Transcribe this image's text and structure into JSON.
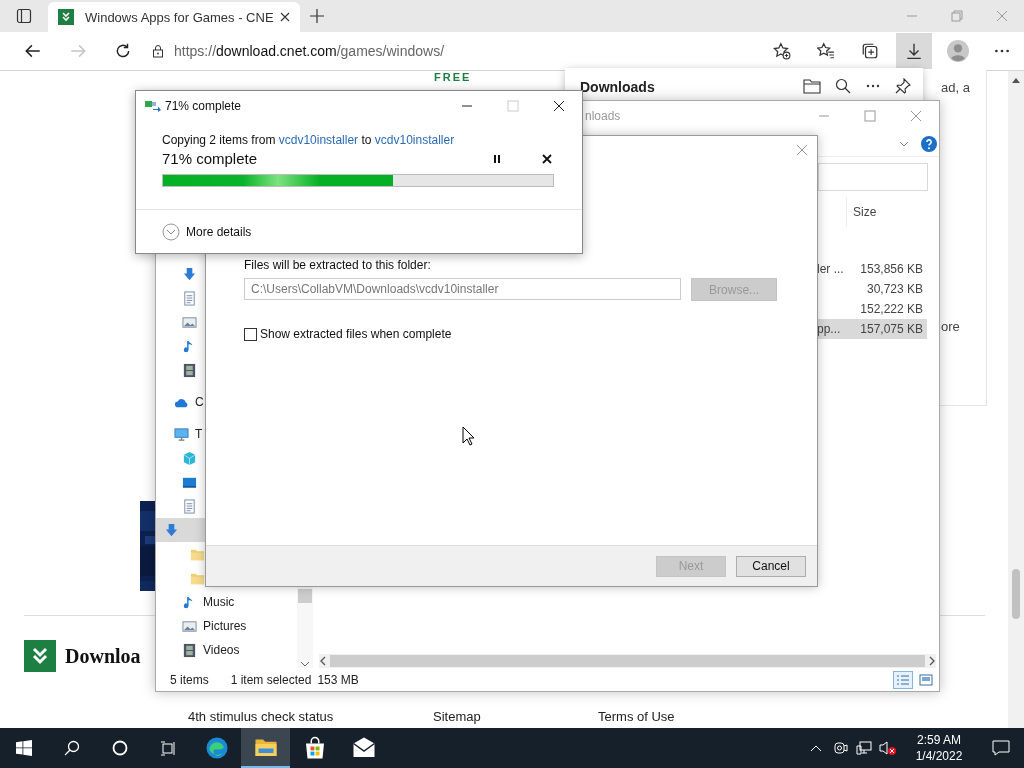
{
  "browser": {
    "tab": {
      "title": "Windows Apps for Games - CNE",
      "selected": true
    },
    "nav_buttons": [
      {
        "kind": "back",
        "disabled": false
      },
      {
        "kind": "forward",
        "disabled": true
      },
      {
        "kind": "refresh",
        "disabled": false
      }
    ],
    "url": {
      "scheme": "https://",
      "host": "download.cnet.com",
      "path": "/games/windows/"
    },
    "toolbar": [
      {
        "kind": "favorite-add",
        "selected": false
      },
      {
        "kind": "favorites",
        "selected": false
      },
      {
        "kind": "collections",
        "selected": false
      },
      {
        "kind": "downloads",
        "selected": true
      },
      {
        "kind": "profile",
        "selected": false
      },
      {
        "kind": "more",
        "selected": false
      }
    ]
  },
  "page": {
    "badge": "FREE",
    "side_texts": [
      "ad, a",
      "ore"
    ],
    "logo_text": "Downloa",
    "footer_links": [
      "4th stimulus check status",
      "Sitemap",
      "Terms of Use"
    ]
  },
  "downloads_panel": {
    "title": "Downloads"
  },
  "explorer": {
    "title": "nloads",
    "size_header": "Size",
    "files": [
      {
        "name": "ler ...",
        "size": "153,856 KB",
        "selected": false
      },
      {
        "size": "30,723 KB",
        "selected": false
      },
      {
        "size": "152,222 KB",
        "selected": false
      },
      {
        "name": "pp...",
        "size": "157,075 KB",
        "selected": true
      }
    ],
    "quick_access": [
      {
        "kind": "download",
        "selected": false
      },
      {
        "kind": "document",
        "selected": false
      },
      {
        "kind": "picture",
        "selected": false
      },
      {
        "kind": "music",
        "selected": false
      },
      {
        "kind": "video",
        "selected": false
      }
    ],
    "tree": [
      {
        "kind": "cloud",
        "label": "C",
        "selected": false
      },
      {
        "kind": "pc",
        "label": "T",
        "selected": false,
        "children": [
          {
            "kind": "cube",
            "selected": false
          },
          {
            "kind": "desktop",
            "selected": false
          },
          {
            "kind": "document",
            "selected": false
          },
          {
            "kind": "download",
            "selected": true,
            "children": [
              {
                "kind": "folder",
                "selected": false
              },
              {
                "kind": "folder",
                "selected": false
              }
            ]
          },
          {
            "kind": "music",
            "label": "Music",
            "selected": false
          },
          {
            "kind": "picture",
            "label": "Pictures",
            "selected": false
          },
          {
            "kind": "video",
            "label": "Videos",
            "selected": false
          }
        ]
      }
    ],
    "status": {
      "items": "5 items",
      "selection": "1 item selected",
      "size": "153 MB"
    }
  },
  "extract_dialog": {
    "folder_label": "Files will be extracted to this folder:",
    "path": "C:\\Users\\CollabVM\\Downloads\\vcdv10installer",
    "browse": {
      "label": "Browse...",
      "disabled": true
    },
    "show_files": {
      "label": "Show extracted files when complete",
      "checked": false
    },
    "buttons": [
      {
        "label": "Next",
        "disabled": true
      },
      {
        "label": "Cancel",
        "disabled": false
      }
    ]
  },
  "copy_dialog": {
    "title": "71% complete",
    "prefix": "Copying 2 items from ",
    "source": "vcdv10installer",
    "middle": " to ",
    "destination": "vcdv10installer",
    "heading": "71% complete",
    "level": 0.59,
    "more": "More details",
    "maximize_disabled": true
  },
  "taskbar": {
    "apps": [
      {
        "kind": "edge",
        "selected": false
      },
      {
        "kind": "explorer",
        "selected": true
      },
      {
        "kind": "store",
        "selected": false
      },
      {
        "kind": "mail",
        "selected": false
      }
    ],
    "time": "2:59 AM",
    "date": "1/4/2022",
    "volume_muted": true
  }
}
